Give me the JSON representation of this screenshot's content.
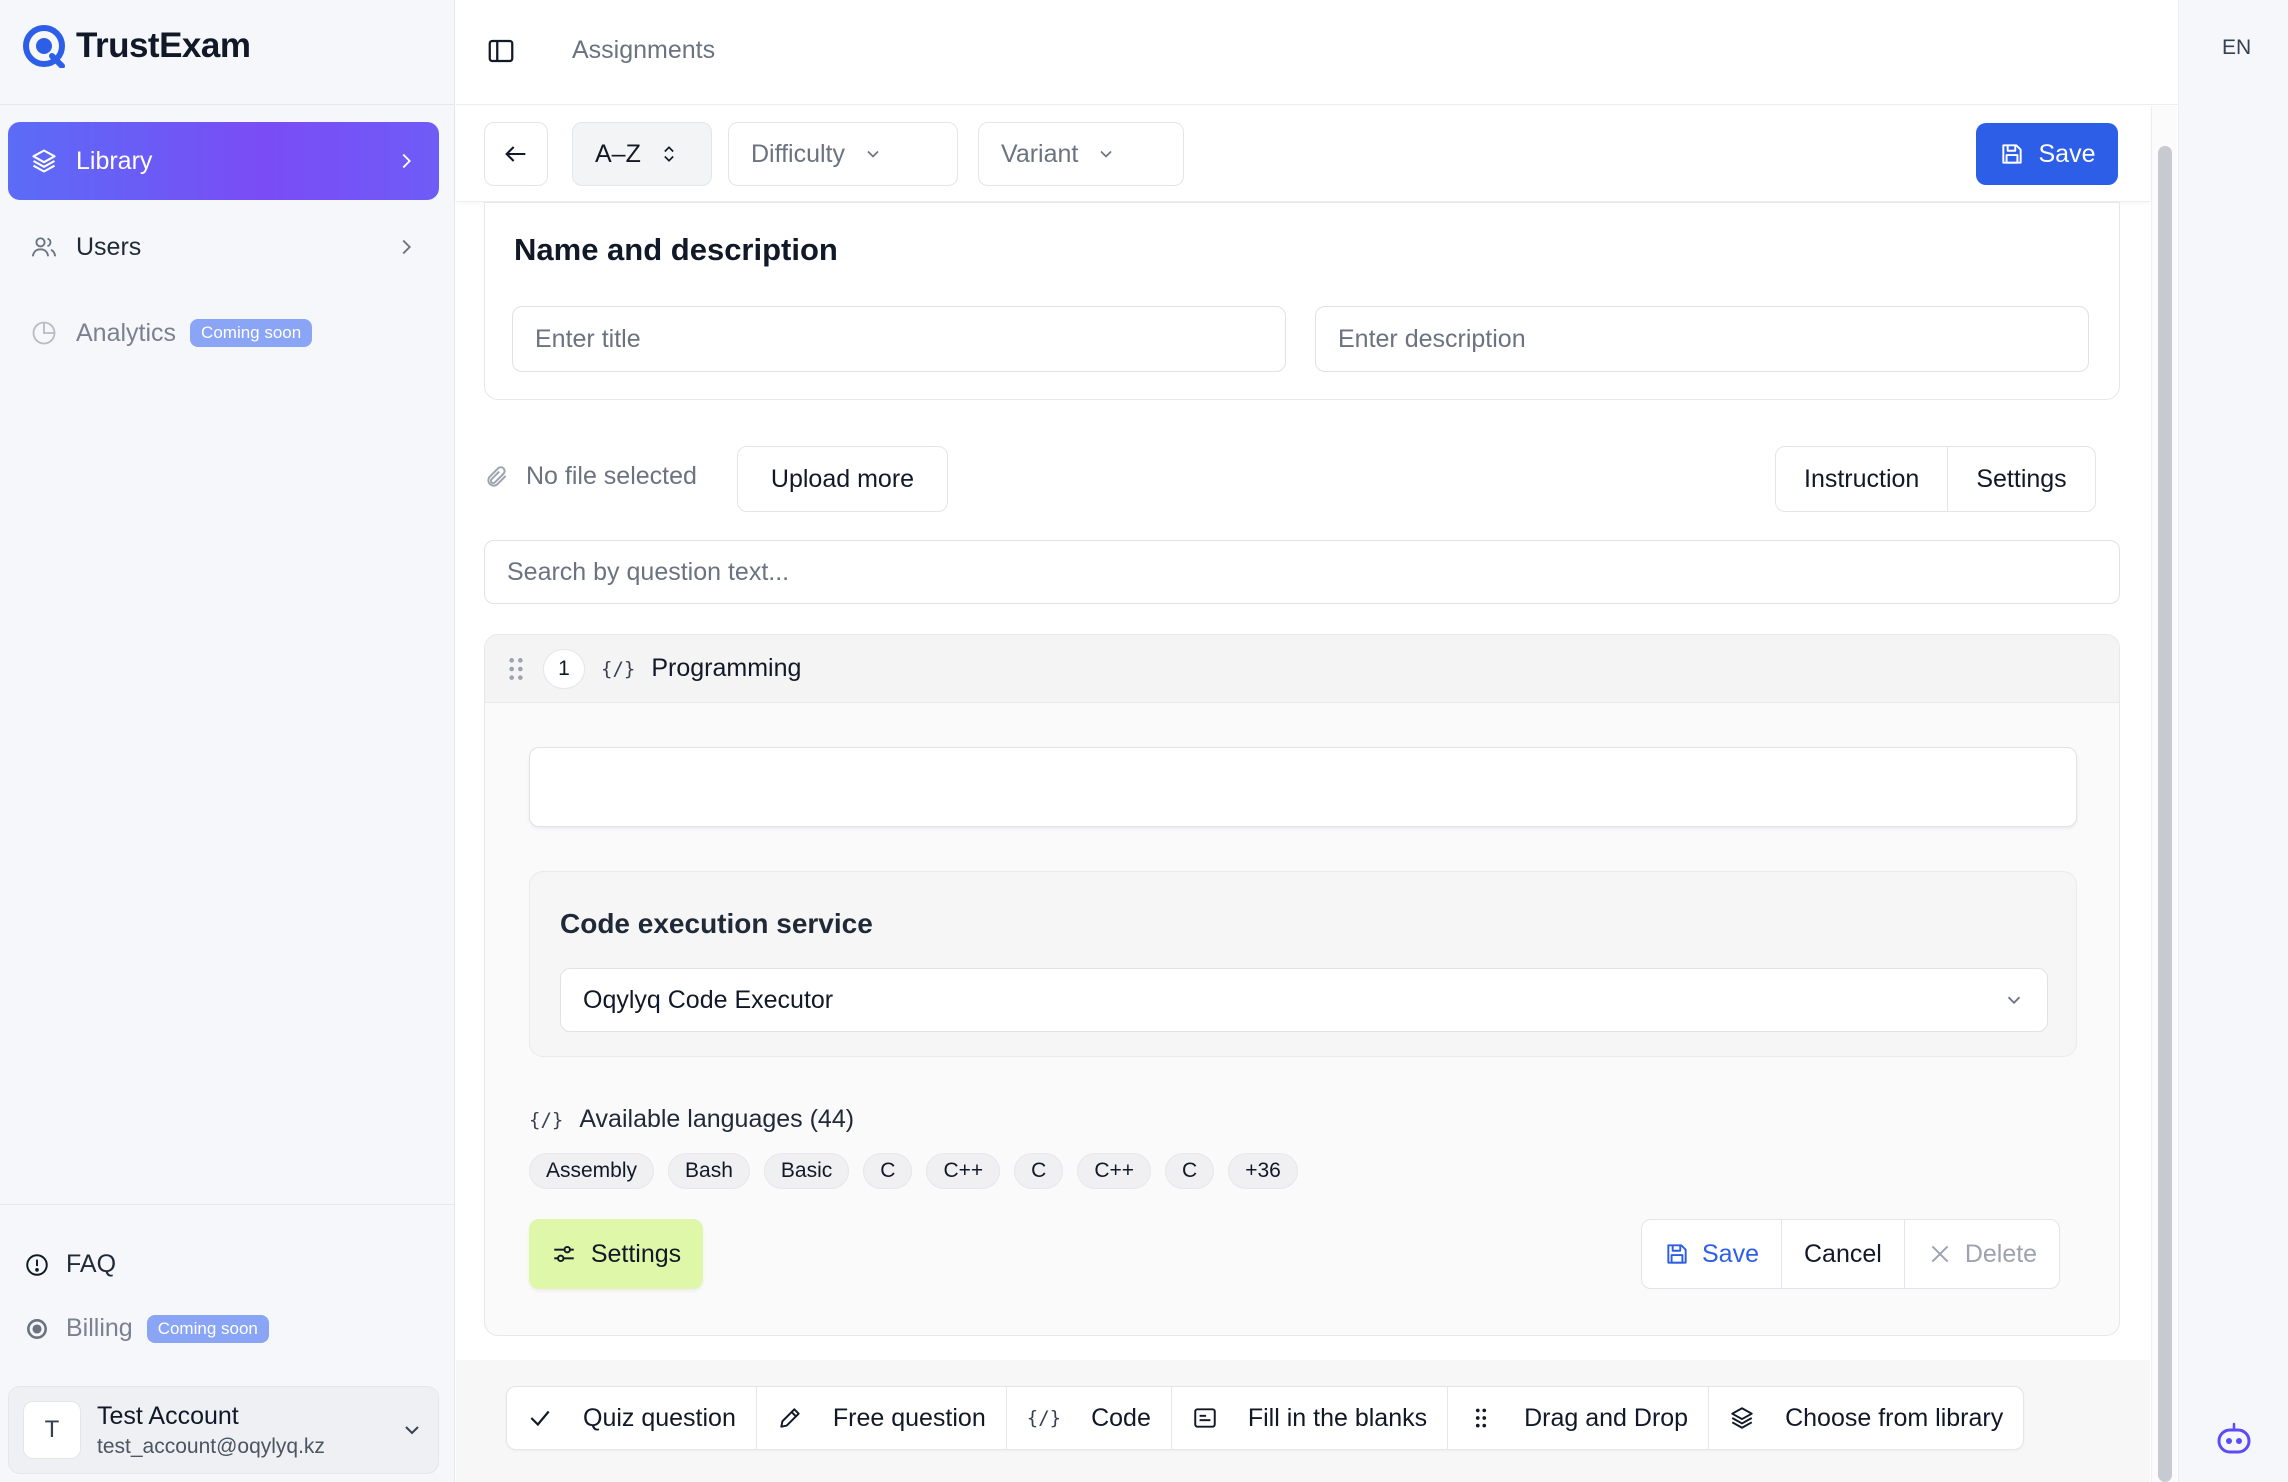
{
  "brand": {
    "name": "TrustExam",
    "accent": "#2d5ee8"
  },
  "sidebar": {
    "items": [
      {
        "label": "Library",
        "icon": "layers-icon",
        "active": true
      },
      {
        "label": "Users",
        "icon": "users-icon"
      },
      {
        "label": "Analytics",
        "icon": "pie-chart-icon",
        "badge": "Coming soon"
      }
    ],
    "bottom": [
      {
        "label": "FAQ",
        "icon": "alert-circle-icon"
      },
      {
        "label": "Billing",
        "icon": "billing-icon",
        "badge": "Coming soon"
      }
    ],
    "account": {
      "initial": "T",
      "name": "Test Account",
      "email": "test_account@oqylyq.kz"
    }
  },
  "topbar": {
    "breadcrumb": "Assignments",
    "language": "EN"
  },
  "toolbar": {
    "sort": "A–Z",
    "difficulty": "Difficulty",
    "variant": "Variant",
    "save": "Save"
  },
  "name_section": {
    "title": "Name and description",
    "title_placeholder": "Enter title",
    "description_placeholder": "Enter description"
  },
  "files": {
    "status": "No file selected",
    "upload": "Upload more",
    "instruction": "Instruction",
    "settings": "Settings"
  },
  "search": {
    "placeholder": "Search by question text..."
  },
  "question": {
    "number": "1",
    "type_icon": "{/}",
    "type": "Programming",
    "execution": {
      "title": "Code execution service",
      "selected": "Oqylyq Code Executor"
    },
    "languages": {
      "heading": "Available languages (44)",
      "chips": [
        "Assembly",
        "Bash",
        "Basic",
        "C",
        "C++",
        "C",
        "C++",
        "C",
        "+36"
      ]
    },
    "settings": "Settings",
    "save": "Save",
    "cancel": "Cancel",
    "delete": "Delete"
  },
  "add_bar": [
    {
      "label": "Quiz question",
      "icon": "check-icon"
    },
    {
      "label": "Free question",
      "icon": "pencil-icon"
    },
    {
      "label": "Code",
      "icon": "code-icon",
      "glyph": "{/}"
    },
    {
      "label": "Fill in the blanks",
      "icon": "text-box-icon"
    },
    {
      "label": "Drag and Drop",
      "icon": "grip-icon"
    },
    {
      "label": "Choose from library",
      "icon": "layers-icon"
    }
  ]
}
